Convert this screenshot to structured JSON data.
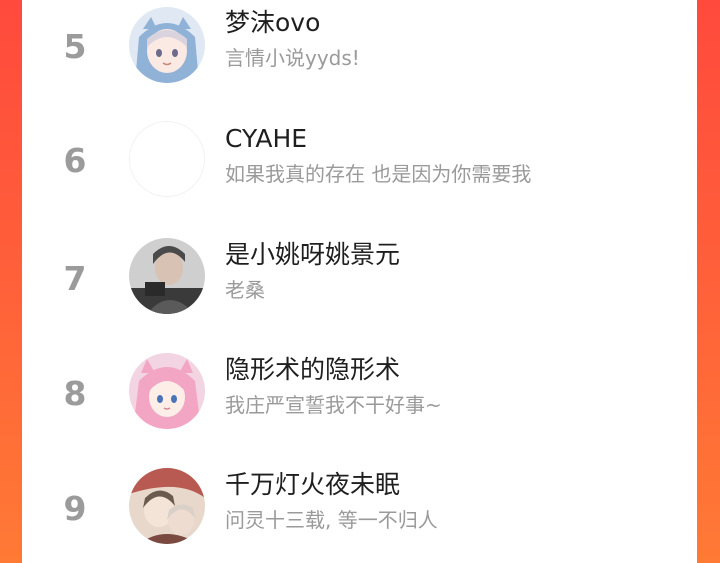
{
  "ranking": {
    "items": [
      {
        "rank": "5",
        "name": "梦沫ovo",
        "signature": "言情小说yyds!",
        "avatar": "anime-girl-shark-hood-avatar"
      },
      {
        "rank": "6",
        "name": "CYAHE",
        "signature": "如果我真的存在 也是因为你需要我",
        "avatar": "blank-avatar"
      },
      {
        "rank": "7",
        "name": "是小姚呀姚景元",
        "signature": "老桑",
        "avatar": "man-photo-avatar"
      },
      {
        "rank": "8",
        "name": "隐形术的隐形术",
        "signature": "我庄严宣誓我不干好事~",
        "avatar": "pink-hair-anime-avatar"
      },
      {
        "rank": "9",
        "name": "千万灯火夜未眠",
        "signature": "问灵十三载, 等一不归人",
        "avatar": "anime-couple-avatar"
      }
    ]
  },
  "colors": {
    "background_gradient_top": "#ff4a3d",
    "background_gradient_bottom": "#ff7a35",
    "card": "#ffffff",
    "rank_text": "#9b9b9b",
    "name_text": "#1f1f1f",
    "signature_text": "#9a9a9a"
  }
}
